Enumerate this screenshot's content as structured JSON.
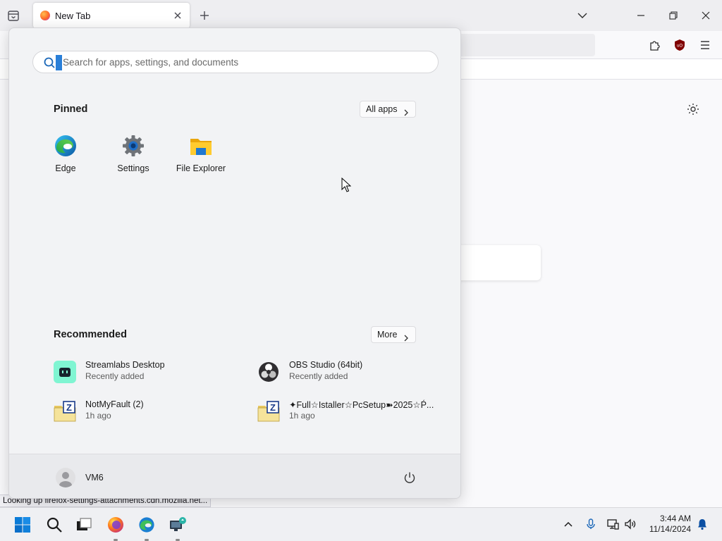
{
  "browser": {
    "tab_title": "New Tab",
    "status_text": "Looking up firefox-settings-attachments.cdn.mozilla.net..."
  },
  "start_menu": {
    "search_placeholder": "Search for apps, settings, and documents",
    "pinned_title": "Pinned",
    "all_apps_label": "All apps",
    "pinned": [
      {
        "label": "Edge",
        "icon": "edge-icon"
      },
      {
        "label": "Settings",
        "icon": "settings-gear-icon"
      },
      {
        "label": "File Explorer",
        "icon": "folder-icon"
      }
    ],
    "recommended_title": "Recommended",
    "more_label": "More",
    "recommended": [
      {
        "name": "Streamlabs Desktop",
        "sub": "Recently added",
        "icon": "streamlabs-icon"
      },
      {
        "name": "OBS Studio (64bit)",
        "sub": "Recently added",
        "icon": "obs-icon"
      },
      {
        "name": "NotMyFault (2)",
        "sub": "1h ago",
        "icon": "zip-folder-icon"
      },
      {
        "name": "✦Full☆Istaller☆PcSetup➽2025☆Ṕ...",
        "sub": "1h ago",
        "icon": "zip-folder-icon"
      }
    ],
    "user_name": "VM6"
  },
  "taskbar": {
    "time": "3:44 AM",
    "date": "11/14/2024"
  },
  "colors": {
    "accent": "#0078d4",
    "start_bg": "#f2f3f5",
    "taskbar_bg": "#eff0f3"
  }
}
